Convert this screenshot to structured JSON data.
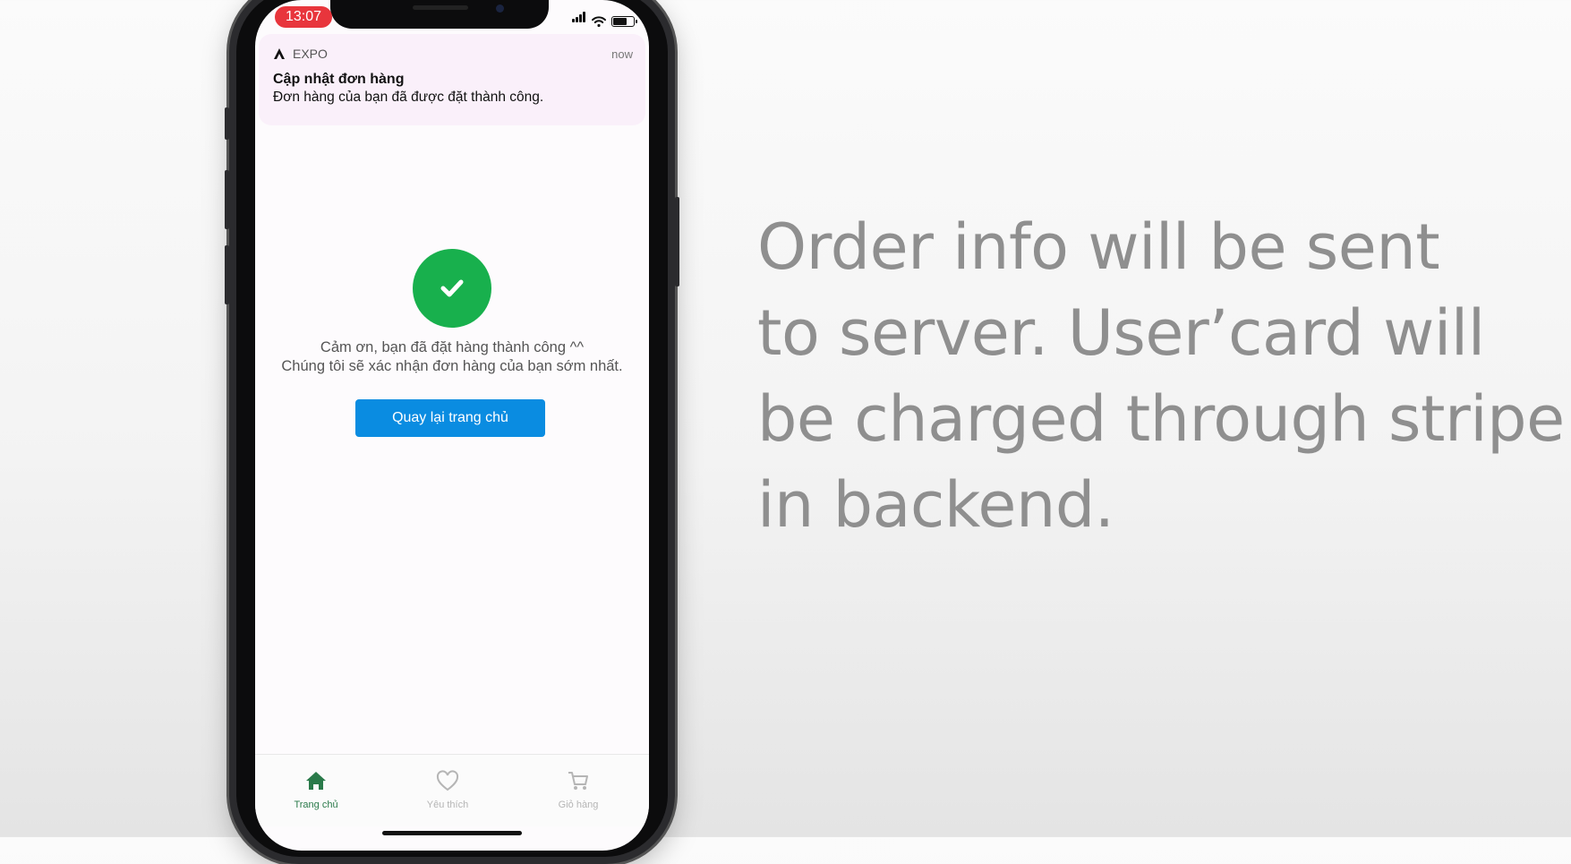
{
  "status_bar": {
    "time": "13:07"
  },
  "notification": {
    "app_name": "EXPO",
    "time": "now",
    "title": "Cập nhật đơn hàng",
    "body": "Đơn hàng của bạn đã được đặt thành công."
  },
  "success": {
    "line1": "Cảm ơn, bạn đã đặt hàng thành công ^^",
    "line2": "Chúng tôi sẽ xác nhận đơn hàng của bạn sớm nhất.",
    "button_label": "Quay lại trang chủ",
    "icon": "checkmark-icon",
    "accent_color": "#18b04d",
    "button_color": "#0a8ce1"
  },
  "tab_bar": {
    "items": [
      {
        "label": "Trang chủ",
        "icon": "home-icon",
        "active": true
      },
      {
        "label": "Yêu thích",
        "icon": "heart-icon",
        "active": false
      },
      {
        "label": "Giỏ hàng",
        "icon": "cart-icon",
        "active": false
      }
    ],
    "active_color": "#2a7a4a"
  },
  "caption": {
    "lines": [
      "Order info will be sent",
      "to server. User’card will",
      "be charged through stripe",
      "in backend."
    ]
  }
}
